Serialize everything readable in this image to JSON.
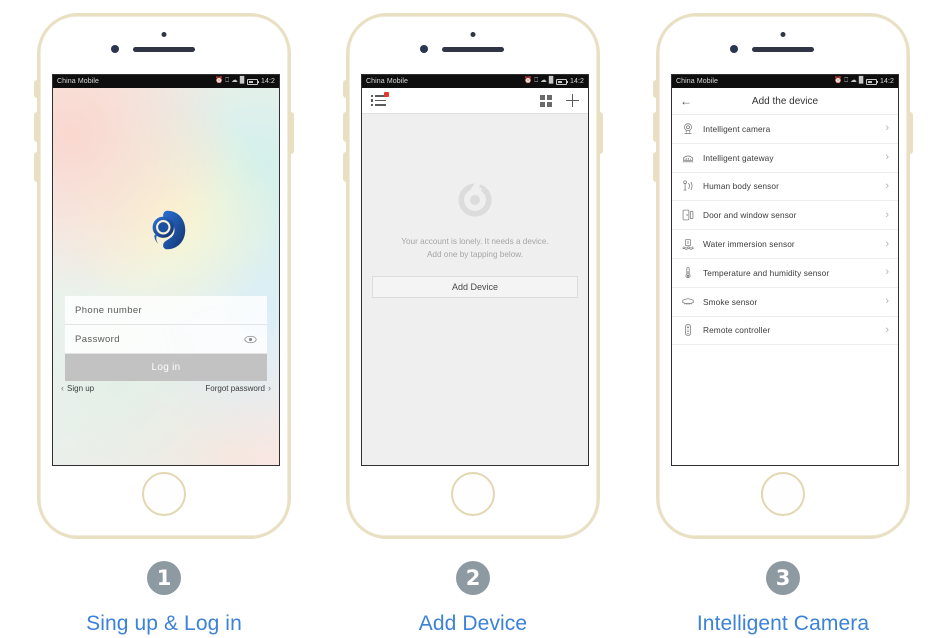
{
  "statusbar": {
    "carrier": "China Mobile",
    "icons": [
      "alarm-icon",
      "sync-icon",
      "wifi-icon",
      "signal-icon"
    ],
    "time": "14:2"
  },
  "steps": [
    {
      "number": "1",
      "caption": "Sing up & Log in"
    },
    {
      "number": "2",
      "caption": "Add Device"
    },
    {
      "number": "3",
      "caption": "Intelligent Camera"
    }
  ],
  "screen1": {
    "logo_name": "app-logo",
    "phone_placeholder": "Phone  number",
    "password_placeholder": "Password",
    "eye_icon": "eye-icon",
    "login_label": "Log in",
    "signup_label": "Sign up",
    "forgot_label": "Forgot password",
    "left_chevron": "‹",
    "right_chevron": "›"
  },
  "screen2": {
    "toolbar": {
      "list_icon": "list-menu-icon",
      "grid_icon": "grid-view-icon",
      "plus_icon": "add-plus-icon"
    },
    "watermark_icon": "app-watermark-logo",
    "empty_line1": "Your account is lonely. It needs a device.",
    "empty_line2": "Add one by tapping below.",
    "add_device_label": "Add Device"
  },
  "screen3": {
    "back_icon": "←",
    "title": "Add the device",
    "chevron": "›",
    "devices": [
      {
        "label": "Intelligent camera",
        "icon": "camera-icon"
      },
      {
        "label": "Intelligent gateway",
        "icon": "gateway-icon"
      },
      {
        "label": "Human body sensor",
        "icon": "motion-sensor-icon"
      },
      {
        "label": "Door and window sensor",
        "icon": "door-sensor-icon"
      },
      {
        "label": "Water immersion sensor",
        "icon": "water-sensor-icon"
      },
      {
        "label": "Temperature and humidity sensor",
        "icon": "thermometer-icon"
      },
      {
        "label": "Smoke sensor",
        "icon": "smoke-detector-icon"
      },
      {
        "label": "Remote controller",
        "icon": "remote-control-icon"
      }
    ]
  },
  "colors": {
    "caption_blue": "#3b82d8",
    "circle_gray": "#8d9aa2",
    "bezel_gold": "#e9e0c4",
    "badge_red": "#e23b2e",
    "logo_blue": "#1e4f9c"
  }
}
